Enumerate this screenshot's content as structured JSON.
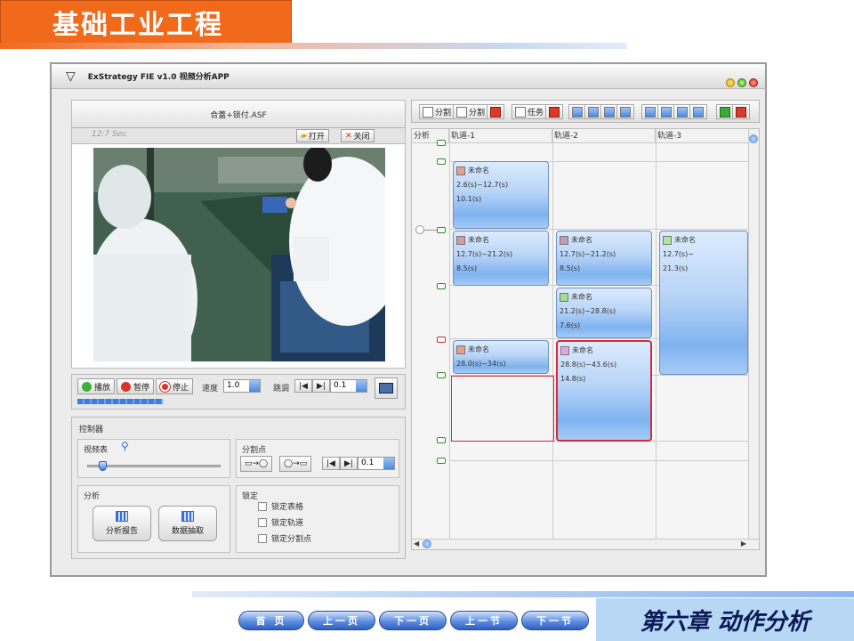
{
  "slide": {
    "title": "基础工业工程",
    "chapter": "第六章 动作分析",
    "nav": [
      "首 页",
      "上一页",
      "下一页",
      "上一节",
      "下一节"
    ]
  },
  "window": {
    "title": "ExStrategy FIE v1.0   视频分析APP",
    "file_name": "合蓋+锁付.ASF",
    "video_time": "12:7 Sec",
    "open_label": "打开",
    "close_label": "关闭",
    "play_label": "播放",
    "pause_label": "暂停",
    "stop_label": "停止",
    "speed_label": "速度",
    "speed_value": "1.0",
    "step_label": "跳调",
    "step_value": "0.1",
    "controller_label": "控制器",
    "zoom_label": "视频表",
    "split_label": "分割点",
    "split_value": "0.1",
    "analysis_label": "分析",
    "report_button": "分析报告",
    "extract_button": "数据抽取",
    "lock_label": "锁定",
    "lock_options": [
      "锁定表格",
      "锁定轨道",
      "锁定分割点"
    ]
  },
  "timeline": {
    "toolbar": {
      "split_a": "分割",
      "split_b": "分割",
      "task": "任务"
    },
    "analysis_col": "分析",
    "tracks": [
      "轨道-1",
      "轨道-2",
      "轨道-3"
    ],
    "blocks": [
      {
        "name": "未命名",
        "range": "2.6(s)~12.7(s)",
        "duration": "10.1(s)",
        "color": "#e59c94"
      },
      {
        "name": "未命名",
        "range": "12.7(s)~21.2(s)",
        "duration": "8.5(s)",
        "color": "#d49aa4"
      },
      {
        "name": "未命名",
        "range": "28.0(s)~34(s)",
        "duration": "",
        "color": "#e59c94"
      },
      {
        "name": "未命名",
        "range": "12.7(s)~21.2(s)",
        "duration": "8.5(s)",
        "color": "#c798b8"
      },
      {
        "name": "未命名",
        "range": "21.2(s)~28.8(s)",
        "duration": "7.6(s)",
        "color": "#9fe08f"
      },
      {
        "name": "未命名",
        "range": "28.8(s)~43.6(s)",
        "duration": "14.8(s)",
        "color": "#e8a4e0"
      },
      {
        "name": "未命名",
        "range": "12.7(s)~",
        "duration": "21.3(s)",
        "color": "#aee8a0"
      }
    ]
  }
}
